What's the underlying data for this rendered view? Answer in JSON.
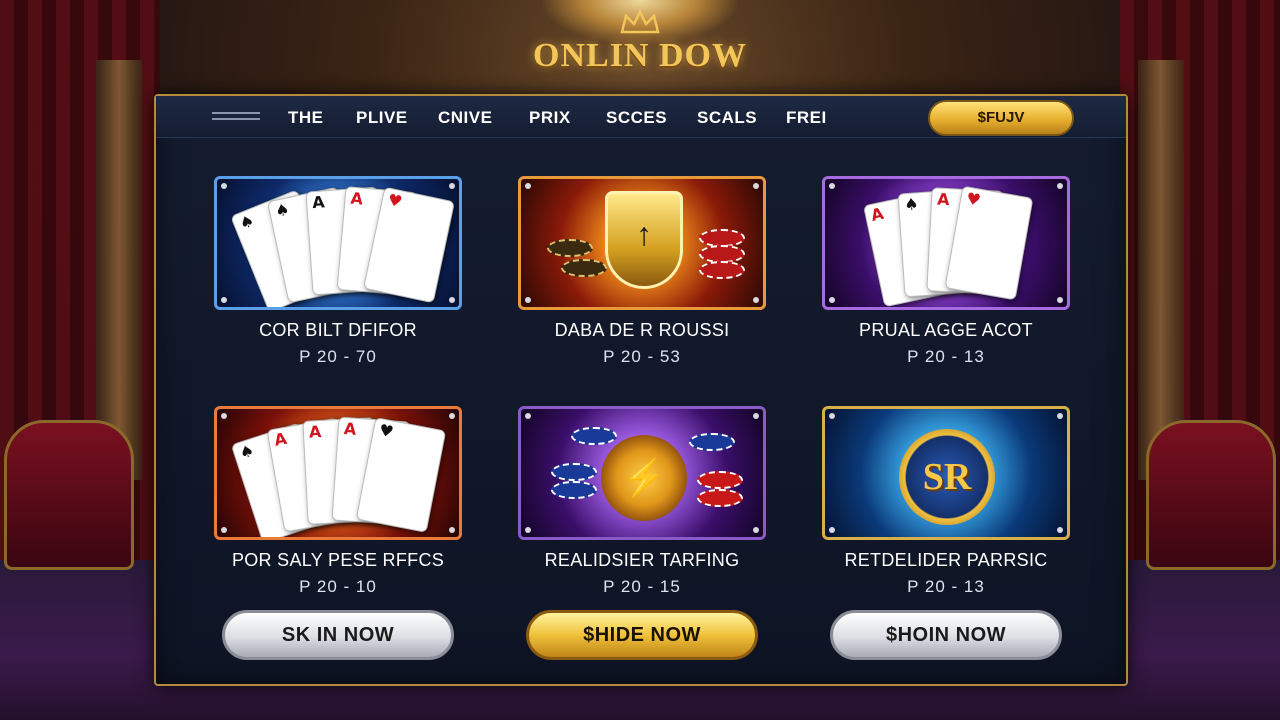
{
  "logo": {
    "text": "ONLIN DOW",
    "icon": "crown-icon"
  },
  "nav": {
    "items": [
      "THE",
      "PLIVE",
      "CNIVE",
      "PRIX",
      "SCCES",
      "SCALS",
      "FREI"
    ],
    "cta_label": "$FUJV"
  },
  "games": [
    {
      "title": "COR BILT DFIFOR",
      "meta": "P 20 - 70",
      "art": "playing-cards",
      "accent": "#5aa0e8"
    },
    {
      "title": "DABA DE R ROUSSI",
      "meta": "P 20 - 53",
      "art": "shield-and-chips",
      "accent": "#e89a3a"
    },
    {
      "title": "PRUAL AGGE ACOT",
      "meta": "P 20 - 13",
      "art": "playing-cards",
      "accent": "#a86ae0"
    },
    {
      "title": "POR SALY PESE RFFCS",
      "meta": "P 20 - 10",
      "art": "playing-cards",
      "accent": "#e87a3a"
    },
    {
      "title": "REALIDSIER TARFING",
      "meta": "P 20 - 15",
      "art": "chips-and-coin",
      "accent": "#8a5ac8"
    },
    {
      "title": "RETDELIDER PARRSIC",
      "meta": "P 20 - 13",
      "art": "sr-emblem",
      "accent": "#d8b04a"
    }
  ],
  "art_text": {
    "shield": "↑",
    "coin": "⚡",
    "emblem": "SR"
  },
  "buttons": [
    {
      "label": "SK IN NOW",
      "style": "silver"
    },
    {
      "label": "$HIDE NOW",
      "style": "gold"
    },
    {
      "label": "$HOIN NOW",
      "style": "silver"
    }
  ],
  "colors": {
    "gold": "#f3c65a",
    "panel": "#141c30",
    "panel_border": "#b48a3c"
  }
}
